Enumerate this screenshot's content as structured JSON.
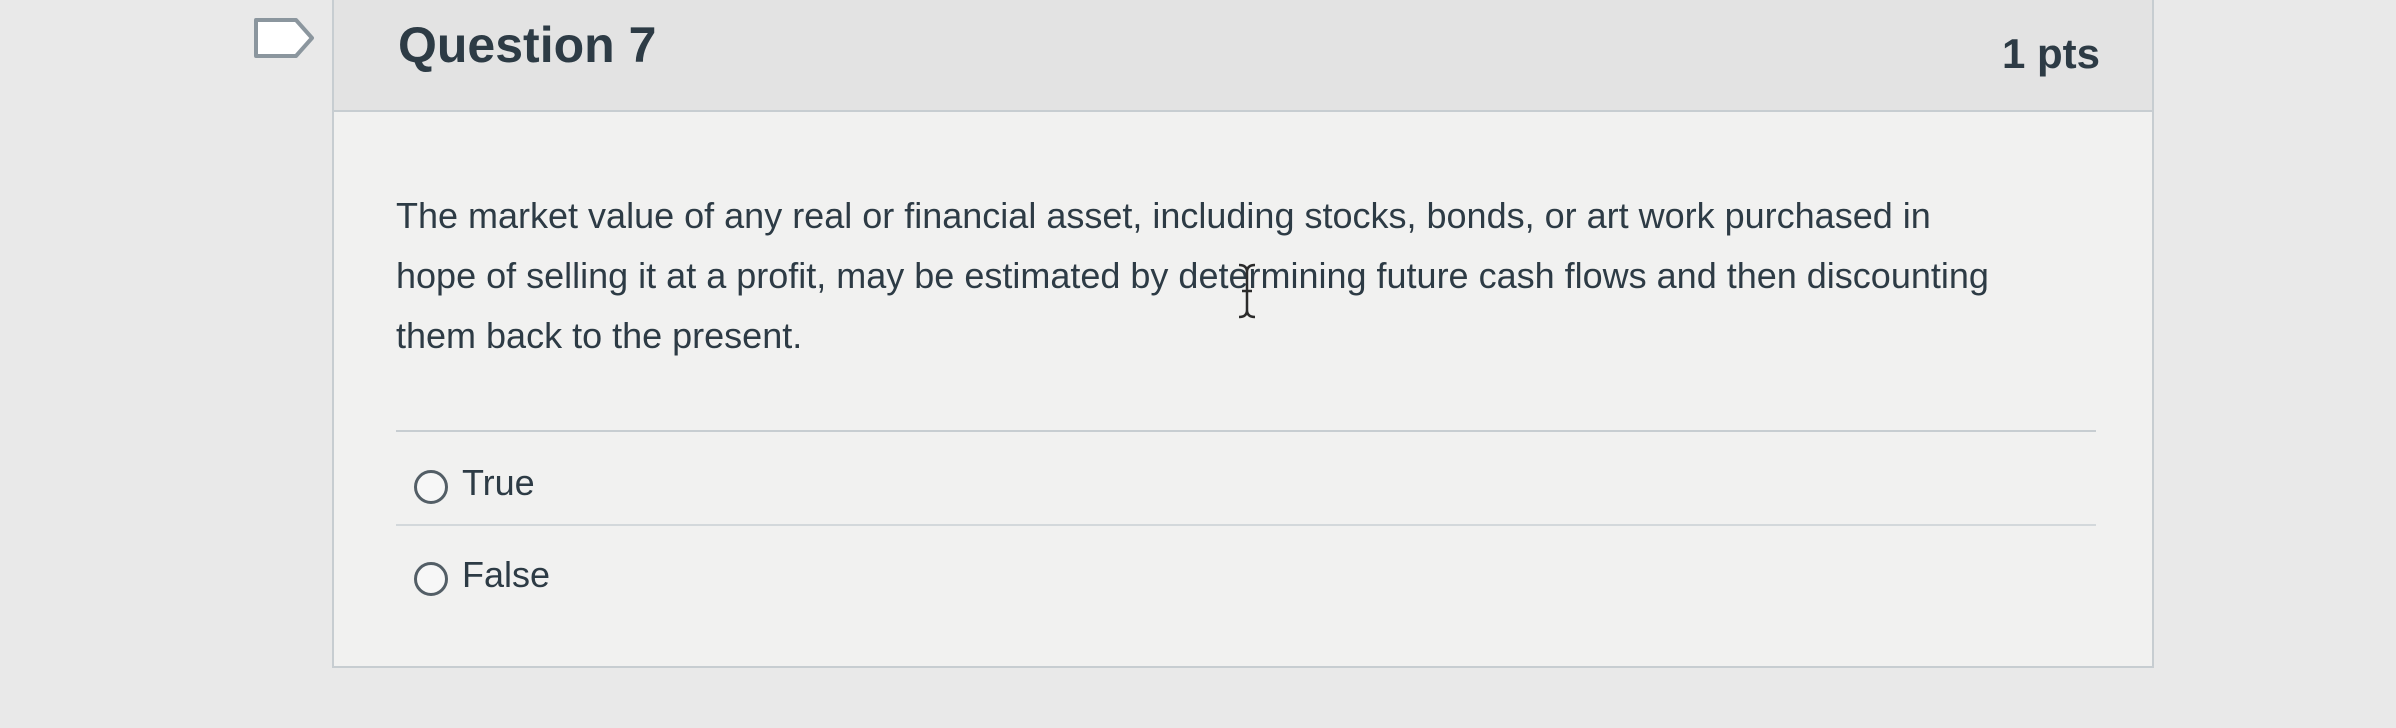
{
  "question": {
    "title": "Question 7",
    "points": "1 pts",
    "text": "The market value of any real or financial asset, including stocks, bonds, or art work purchased in hope of selling it at a profit, may be estimated by determining future cash flows and then discounting them back to the present.",
    "answers": [
      {
        "label": "True",
        "selected": false
      },
      {
        "label": "False",
        "selected": false
      }
    ]
  },
  "icons": {
    "flag": "flag-outline-icon",
    "cursor": "text-cursor-icon"
  },
  "colors": {
    "background": "#e9e9e9",
    "header": "#e3e3e3",
    "text": "#2d3b45",
    "border": "#c7cdd1"
  }
}
